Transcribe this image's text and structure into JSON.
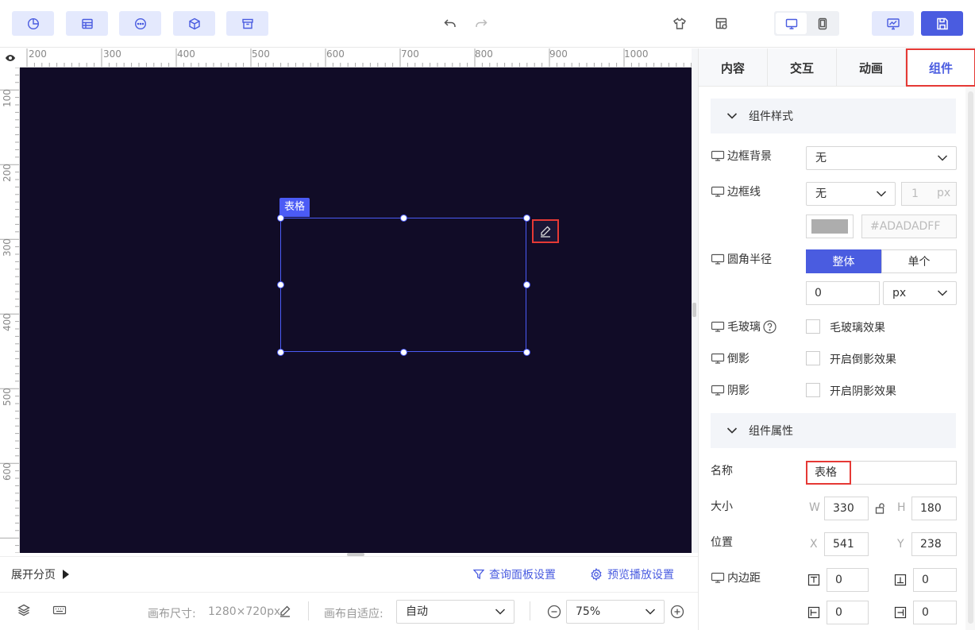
{
  "toolbar": {
    "left_buttons": [
      "chart-icon",
      "table-icon",
      "more-icon",
      "cube-icon",
      "archive-icon"
    ],
    "undo": "undo-icon",
    "redo": "redo-icon",
    "right_icons": [
      "theme-icon",
      "grid-settings-icon"
    ],
    "device_toggle": [
      "desktop-icon",
      "mobile-icon"
    ],
    "preview": "preview-icon",
    "save": "save-icon"
  },
  "ruler": {
    "h_labels": [
      "200",
      "300",
      "400",
      "500",
      "600",
      "700",
      "800",
      "900",
      "1000"
    ],
    "v_labels": [
      "100",
      "200",
      "300",
      "400",
      "500",
      "600"
    ]
  },
  "selection": {
    "tag": "表格"
  },
  "pagebar": {
    "expand_label": "展开分页",
    "query_panel": "查询面板设置",
    "preview_settings": "预览播放设置"
  },
  "status": {
    "canvas_size_label": "画布尺寸:",
    "canvas_size_value": "1280×720px",
    "fit_label": "画布自适应:",
    "fit_value": "自动",
    "zoom_value": "75%"
  },
  "panel": {
    "tabs": [
      "内容",
      "交互",
      "动画",
      "组件"
    ],
    "active_tab": "组件",
    "style_section": "组件样式",
    "border_bg_label": "边框背景",
    "border_bg_value": "无",
    "border_line_label": "边框线",
    "border_line_value": "无",
    "border_width_value": "1",
    "border_width_unit": "px",
    "border_color_value": "#ADADADFF",
    "border_color_swatch": "#adadad",
    "radius_label": "圆角半径",
    "radius_whole": "整体",
    "radius_single": "单个",
    "radius_value": "0",
    "radius_unit": "px",
    "frost_label": "毛玻璃",
    "frost_check": "毛玻璃效果",
    "reflect_label": "倒影",
    "reflect_check": "开启倒影效果",
    "shadow_label": "阴影",
    "shadow_check": "开启阴影效果",
    "props_section": "组件属性",
    "name_label": "名称",
    "name_value": "表格",
    "size_label": "大小",
    "w_label": "W",
    "w_value": "330",
    "h_label": "H",
    "h_value": "180",
    "pos_label": "位置",
    "x_label": "X",
    "x_value": "541",
    "y_label": "Y",
    "y_value": "238",
    "padding_label": "内边距",
    "pad_top": "0",
    "pad_bottom": "0",
    "pad_left": "0",
    "pad_right": "0"
  },
  "colors": {
    "accent": "#4a5ce0",
    "canvas_bg": "#110c27",
    "highlight": "#e53935"
  }
}
